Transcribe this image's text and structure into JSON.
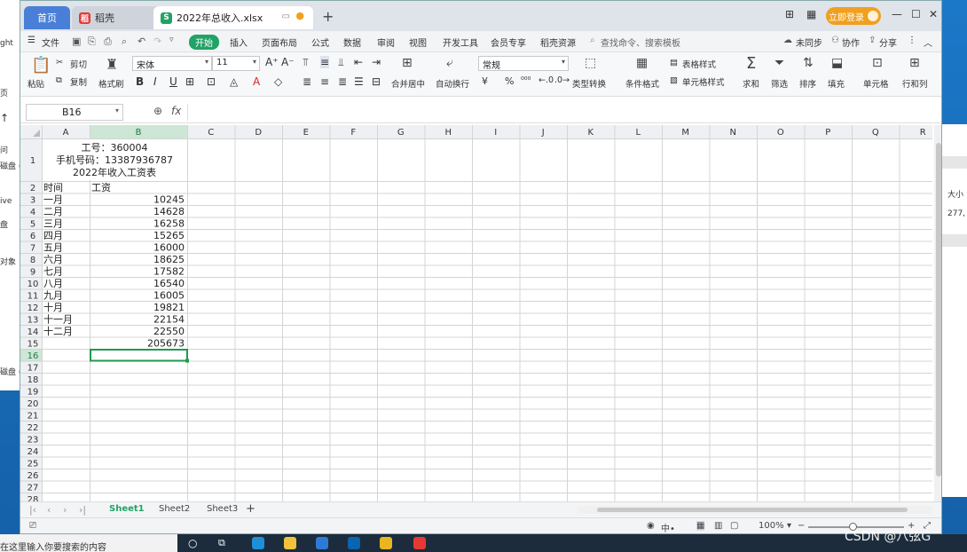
{
  "background": {
    "left_fragments": [
      "ght",
      "问",
      "磁盘 (",
      "ive",
      "盘",
      "对象",
      "磁盘 ("
    ],
    "left_page_label": "页",
    "right_fragments": [
      "大小",
      "277,"
    ]
  },
  "tabs": {
    "home": "首页",
    "daoke": "稻壳",
    "file": "2022年总收入.xlsx",
    "login": "立即登录"
  },
  "menu": {
    "file": "文件",
    "items": [
      "开始",
      "插入",
      "页面布局",
      "公式",
      "数据",
      "审阅",
      "视图",
      "开发工具",
      "会员专享",
      "稻壳资源"
    ],
    "search": "查找命令、搜索模板",
    "sync": "未同步",
    "collab": "协作",
    "share": "分享"
  },
  "ribbon": {
    "paste": "粘贴",
    "cut": "剪切",
    "copy": "复制",
    "format_painter": "格式刷",
    "font_name": "宋体",
    "font_size": "11",
    "merge": "合并居中",
    "wrap": "自动换行",
    "number_format": "常规",
    "type_convert": "类型转换",
    "cond_format": "条件格式",
    "table_style": "表格样式",
    "cell_style": "单元格样式",
    "sum": "求和",
    "filter": "筛选",
    "sort": "排序",
    "fill": "填充",
    "cell": "单元格",
    "rowcol": "行和列"
  },
  "formula_bar": {
    "name_box": "B16",
    "fx": "fx",
    "value": ""
  },
  "sheet": {
    "columns": [
      "A",
      "B",
      "C",
      "D",
      "E",
      "F",
      "G",
      "H",
      "I",
      "J",
      "K",
      "L",
      "M",
      "N",
      "O",
      "P",
      "Q",
      "R"
    ],
    "header_lines": [
      "工号：360004",
      "手机号码：13387936787",
      "2022年收入工资表"
    ],
    "labels": [
      "时间",
      "工资"
    ],
    "rows": [
      {
        "month": "一月",
        "salary": "10245"
      },
      {
        "month": "二月",
        "salary": "14628"
      },
      {
        "month": "三月",
        "salary": "16258"
      },
      {
        "month": "四月",
        "salary": "15265"
      },
      {
        "month": "五月",
        "salary": "16000"
      },
      {
        "month": "六月",
        "salary": "18625"
      },
      {
        "month": "七月",
        "salary": "17582"
      },
      {
        "month": "八月",
        "salary": "16540"
      },
      {
        "month": "九月",
        "salary": "16005"
      },
      {
        "month": "十月",
        "salary": "19821"
      },
      {
        "month": "十一月",
        "salary": "22154"
      },
      {
        "month": "十二月",
        "salary": "22550"
      }
    ],
    "total": "205673",
    "selected_cell": "B16",
    "total_rows": 28
  },
  "sheet_tabs": [
    "Sheet1",
    "Sheet2",
    "Sheet3"
  ],
  "active_sheet": "Sheet1",
  "status": {
    "zoom": "100%"
  },
  "taskbar": {
    "search": "在这里输入你要搜索的内容"
  },
  "watermark": "CSDN @八弦G",
  "colors": {
    "accent_green": "#21a366",
    "home_tab_blue": "#4a7fd8",
    "login_orange": "#f0a020",
    "selection_header": "#cde6d5",
    "selected_cell_border": "#1e9a4f"
  }
}
